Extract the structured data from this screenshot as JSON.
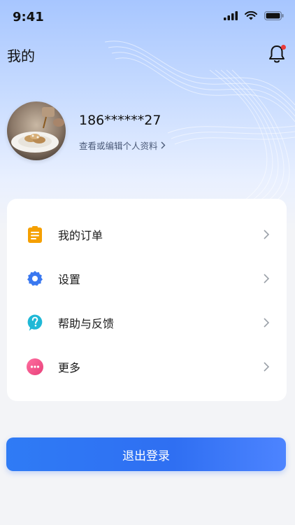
{
  "status_bar": {
    "time": "9:41",
    "icons": [
      "cellular-signal-icon",
      "wifi-icon",
      "battery-icon"
    ]
  },
  "header": {
    "title": "我的",
    "bell_icon": "bell-icon",
    "has_notification": true
  },
  "profile": {
    "phone": "186******27",
    "edit_link": "查看或编辑个人资料"
  },
  "menu": [
    {
      "label": "我的订单",
      "icon": "orders-clipboard-icon",
      "color": "#f5a000"
    },
    {
      "label": "设置",
      "icon": "settings-gear-icon",
      "color": "#3a78f0"
    },
    {
      "label": "帮助与反馈",
      "icon": "help-question-icon",
      "color": "#1fb8d6"
    },
    {
      "label": "更多",
      "icon": "more-dots-icon",
      "color": "#f0508a"
    }
  ],
  "logout": {
    "label": "退出登录"
  },
  "colors": {
    "accent": "#2f6ff2",
    "notification_dot": "#e93a3a"
  }
}
